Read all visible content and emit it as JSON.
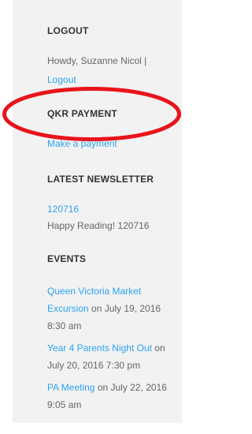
{
  "logout": {
    "title": "LOGOUT",
    "greeting": "Howdy, Suzanne Nicol |",
    "link": "Logout"
  },
  "qkr": {
    "title": "QKR PAYMENT",
    "link": "Make a payment"
  },
  "newsletter": {
    "title": "LATEST NEWSLETTER",
    "link": "120716",
    "caption": "Happy Reading! 120716"
  },
  "events": {
    "title": "EVENTS",
    "items": [
      {
        "link_1": "Queen Victoria Market",
        "link_2": "Excursion",
        "date_1": " on July 19, 2016",
        "date_2": "8:30 am"
      },
      {
        "link_1": "Year 4 Parents Night Out",
        "date_1": " on",
        "date_2": "July 20, 2016 7:30 pm"
      },
      {
        "link_1": "PA Meeting",
        "date_1": " on July 22, 2016",
        "date_2": "9:05 am"
      }
    ]
  },
  "colors": {
    "link": "#2ea3f2",
    "text": "#666666",
    "heading": "#333333",
    "sidebar_bg": "#f2f2f2",
    "highlight_circle": "#e8141b"
  }
}
